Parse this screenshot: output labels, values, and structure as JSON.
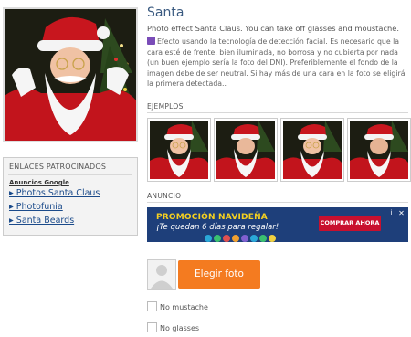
{
  "effect": {
    "title": "Santa",
    "subtitle": "Photo effect Santa Claus. You can take off glasses and moustache.",
    "description": "Efecto usando la tecnología de detección facial. Es necesario que la cara esté de frente, bien iluminada, no borrosa y no cubierta por nada (un buen ejemplo sería la foto del DNI). Preferiblemente el fondo de la imagen debe de ser neutral. Si hay más de una cara en la foto se eligirá la primera detectada.."
  },
  "sponsored": {
    "heading": "ENLACES PATROCINADOS",
    "ads_label": "Anuncios Google",
    "links": [
      "Photos Santa Claus",
      "Photofunia",
      "Santa Beards"
    ]
  },
  "examples": {
    "heading": "EJEMPLOS",
    "count": 4
  },
  "ad": {
    "heading": "ANUNCIO",
    "line1": "PROMOCIÓN NAVIDEÑA",
    "line2": "¡Te quedan 6 días para regalar!",
    "button": "COMPRAR AHORA",
    "info_icon": "info-icon",
    "close_icon": "close-icon",
    "colors": {
      "background": "#1e3f7a",
      "accent": "#f5d020",
      "button": "#c8102e"
    }
  },
  "upload": {
    "button": "Elegir foto",
    "button_color": "#f47b20"
  },
  "options": [
    {
      "label": "No mustache",
      "checked": false
    },
    {
      "label": "No glasses",
      "checked": false
    }
  ],
  "colors": {
    "title": "#3a5a80",
    "link": "#1a4a8a"
  }
}
